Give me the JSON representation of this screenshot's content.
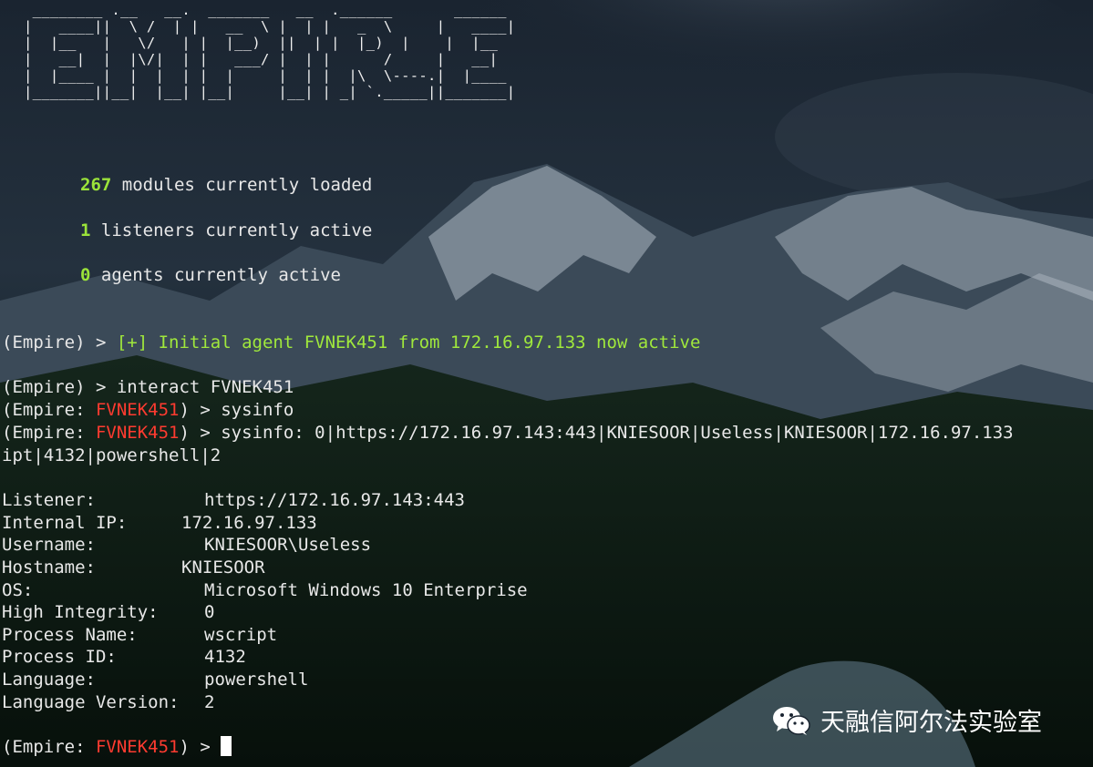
{
  "banner": {
    "ascii_art": " ________ .__   __.  _______   __  .______       ______\n|   ____||  \\ /  | |   __  \\ |  | |   _  \\     |   ____|\n|  |__   |   \\/   | |  |__)  ||  | |  |_)  |    |  |__\n|   __|  |  |\\/|  | |   ___/ |  | |      /     |   __|\n|  |____ |  |  |  | |  |     |  | |  |\\  \\----.|  |____\n|_______||__|  |__| |__|     |__| | _| `._____||_______|"
  },
  "stats": [
    {
      "count": "267",
      "label": " modules currently loaded"
    },
    {
      "count": "1",
      "label": " listeners currently active"
    },
    {
      "count": "0",
      "label": " agents currently active"
    }
  ],
  "log": {
    "prompt": "(Empire) > ",
    "notice": "[+] Initial agent FVNEK451 from 172.16.97.133 now active",
    "interact_cmd": "(Empire) > interact FVNEK451",
    "agent_prompt_open": "(Empire: ",
    "agent_name": "FVNEK451",
    "agent_prompt_close": ") > ",
    "sysinfo_cmd": "sysinfo",
    "sysinfo_output": "sysinfo: 0|https://172.16.97.143:443|KNIESOOR|Useless|KNIESOOR|172.16.97.133",
    "sysinfo_wrap": "ipt|4132|powershell|2"
  },
  "sysinfo": [
    {
      "key": "Listener:",
      "value": "https://172.16.97.143:443"
    },
    {
      "key": "Internal IP:",
      "value": "172.16.97.133"
    },
    {
      "key": "Username:",
      "value": "KNIESOOR\\Useless"
    },
    {
      "key": "Hostname:",
      "value": "KNIESOOR"
    },
    {
      "key": "OS:",
      "value": "Microsoft Windows 10 Enterprise"
    },
    {
      "key": "High Integrity:",
      "value": "0"
    },
    {
      "key": "Process Name:",
      "value": "wscript"
    },
    {
      "key": "Process ID:",
      "value": "4132"
    },
    {
      "key": "Language:",
      "value": "powershell"
    },
    {
      "key": "Language Version:",
      "value": "2"
    }
  ],
  "watermark": {
    "text": "天融信阿尔法实验室",
    "icon": "wechat-icon"
  },
  "colors": {
    "green": "#a0e83c",
    "red": "#ff3b30",
    "text": "#e8e8e8"
  }
}
